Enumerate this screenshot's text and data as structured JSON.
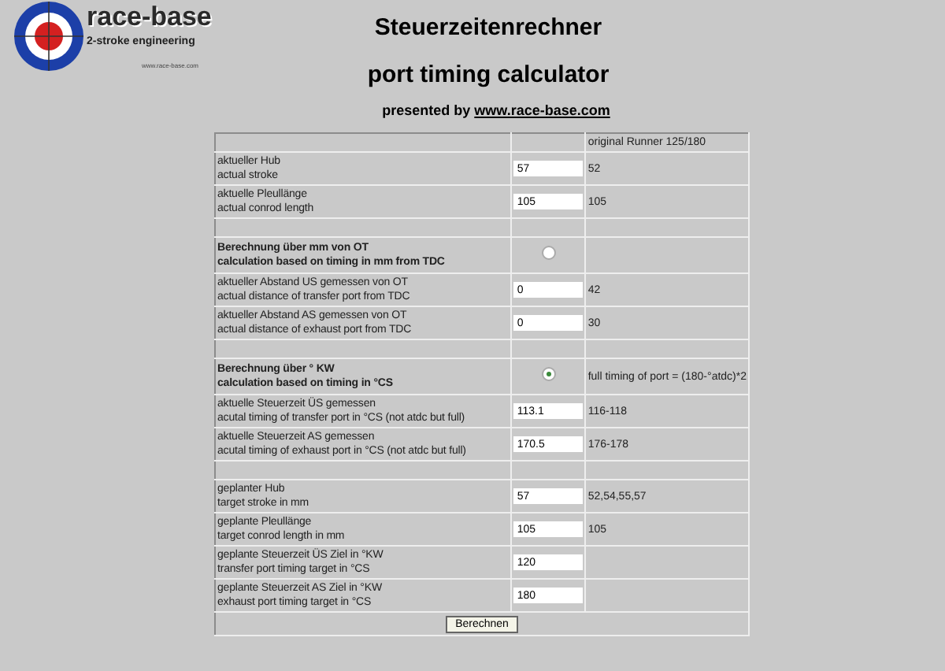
{
  "logo": {
    "name": "race-base",
    "tagline": "2-stroke engineering",
    "url": "www.race-base.com"
  },
  "title": "Steuerzeitenrechner",
  "subtitle": "port timing calculator",
  "presented": {
    "prefix": "presented by ",
    "link": "www.race-base.com"
  },
  "rows": [
    {
      "kind": "header",
      "note": "original Runner 125/180"
    },
    {
      "kind": "input",
      "label": [
        "aktueller Hub",
        "actual stroke"
      ],
      "value": "57",
      "note": "52"
    },
    {
      "kind": "input",
      "label": [
        "aktuelle Pleullänge",
        "actual conrod length"
      ],
      "value": "105",
      "note": "105"
    },
    {
      "kind": "spacer"
    },
    {
      "kind": "section",
      "label": [
        "Berechnung über mm von OT",
        "calculation based on timing in mm from TDC"
      ],
      "selected": false
    },
    {
      "kind": "input",
      "label": [
        "aktueller Abstand US gemessen von OT",
        "actual distance of transfer port from TDC"
      ],
      "value": "0",
      "note": "42"
    },
    {
      "kind": "input",
      "label": [
        "aktueller Abstand AS gemessen von OT",
        "actual distance of exhaust port from TDC"
      ],
      "value": "0",
      "note": "30"
    },
    {
      "kind": "spacer"
    },
    {
      "kind": "section",
      "label": [
        "Berechnung über ° KW",
        "calculation based on timing in °CS"
      ],
      "selected": true,
      "note": "full timing of port = (180-°atdc)*2"
    },
    {
      "kind": "input",
      "label": [
        "aktuelle Steuerzeit ÜS gemessen",
        "acutal timing of transfer port in °CS (not atdc but full)"
      ],
      "value": "113.1",
      "note": "116-118"
    },
    {
      "kind": "input",
      "label": [
        "aktuelle Steuerzeit AS gemessen",
        "acutal timing of exhaust port in °CS (not atdc but full)"
      ],
      "value": "170.5",
      "note": "176-178"
    },
    {
      "kind": "spacer"
    },
    {
      "kind": "input",
      "label": [
        "geplanter Hub",
        "target stroke in mm"
      ],
      "value": "57",
      "note": "52,54,55,57"
    },
    {
      "kind": "input",
      "label": [
        "geplante Pleullänge",
        "target conrod length in mm"
      ],
      "value": "105",
      "note": "105"
    },
    {
      "kind": "input",
      "label": [
        "geplante Steuerzeit ÜS Ziel in °KW",
        "transfer port timing target in °CS"
      ],
      "value": "120"
    },
    {
      "kind": "input",
      "label": [
        "geplante Steuerzeit AS Ziel in °KW",
        "exhaust port timing target in °CS"
      ],
      "value": "180"
    }
  ],
  "button": "Berechnen"
}
